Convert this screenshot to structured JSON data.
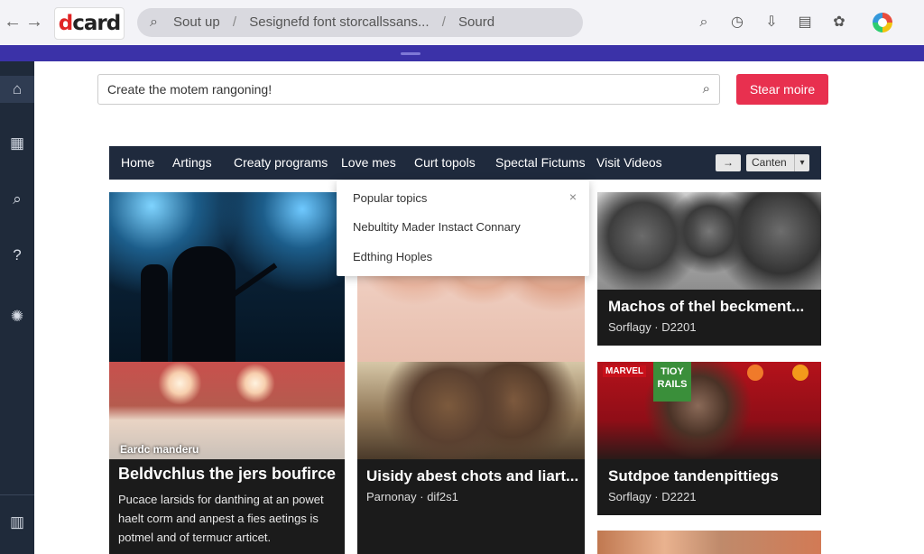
{
  "browser": {
    "logo_prefix": "d",
    "logo_rest": "card",
    "omnibox": {
      "left": "Sout up",
      "middle": "Sesignefd font storcallssans...",
      "right": "Sourd"
    }
  },
  "search": {
    "placeholder": "Create the motem rangoning!",
    "cta_label": "Stear moire"
  },
  "nav": {
    "items": [
      "Home",
      "Artings",
      "Creaty programs",
      "Love mes",
      "Curt topols",
      "Spectal Fictums",
      "Visit Videos"
    ],
    "swap_glyph": "→",
    "select_value": "Canten"
  },
  "dropdown": {
    "items": [
      "Popular topics",
      "Nebultity Mader Instact Connary",
      "Edthing Hoples"
    ],
    "close_glyph": "×"
  },
  "cards": {
    "left_top": {},
    "left_bottom": {
      "overlay": "Eardc manderu",
      "title": "Beldvchlus the jers boufirce",
      "body_lines": [
        "Pucace larsids for danthing at an powet",
        "haelt corm and anpest a fies aetings is",
        "potmel and of termucr articet."
      ]
    },
    "mid_top": {},
    "mid_bottom": {
      "title": "Uisidy abest chots and liart...",
      "meta": "Parnonay · dif2s1"
    },
    "right_top": {
      "title": "Machos of thel beckment...",
      "meta": "Sorflagy · D2201"
    },
    "right_mid": {
      "badge_left": "MARVEL",
      "badge_sign": "TIOY\nRAILS",
      "title": "Sutdpoe tandenpittiegs",
      "meta": "Sorflagy · D2221"
    }
  },
  "colors": {
    "accent_bar": "#3b32a8",
    "cta": "#e8304f",
    "navbar": "#1f2a3d",
    "rail": "#1f2a3a"
  },
  "icons": {
    "toolbar": [
      "search-icon",
      "info-icon",
      "download-icon",
      "card-icon",
      "extension-icon",
      "profile-icon"
    ],
    "rail": [
      "home-icon",
      "calendar-icon",
      "search-icon",
      "help-icon",
      "settings-icon",
      "grid-icon"
    ]
  }
}
